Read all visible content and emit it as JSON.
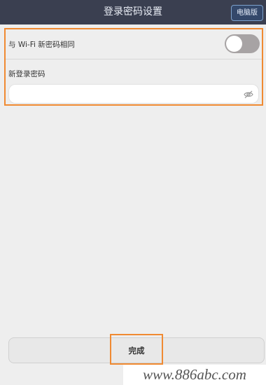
{
  "header": {
    "title": "登录密码设置",
    "pc_button": "电脑版"
  },
  "settings": {
    "same_as_wifi_label": "与 Wi-Fi 新密码相同",
    "same_as_wifi_enabled": false,
    "new_password_label": "新登录密码",
    "new_password_value": "",
    "new_password_placeholder": ""
  },
  "actions": {
    "done_label": "完成"
  },
  "watermark": {
    "text": "www.886abc.com"
  },
  "icons": {
    "password_visibility": "eye-slash-icon"
  },
  "colors": {
    "header_bg": "#3a3f50",
    "highlight": "#f08a32",
    "toggle_off": "#a7a3a4"
  }
}
